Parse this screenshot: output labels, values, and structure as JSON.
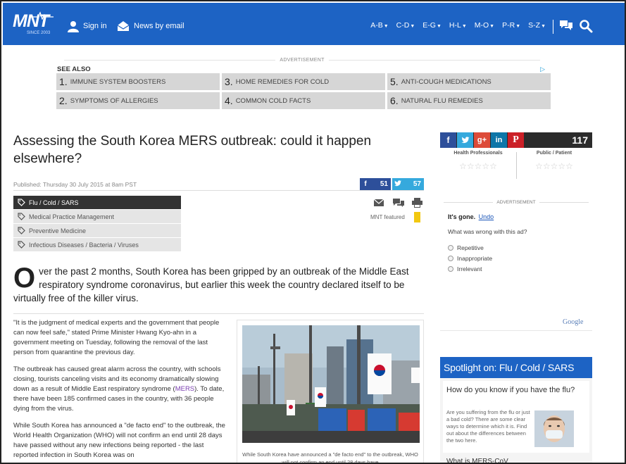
{
  "header": {
    "logo_text": "MNT",
    "logo_since": "SINCE 2003",
    "sign_in": "Sign in",
    "news_by_email": "News by email",
    "az_menu": [
      "A-B",
      "C-D",
      "E-G",
      "H-L",
      "M-O",
      "P-R",
      "S-Z"
    ]
  },
  "ad": {
    "label": "ADVERTISEMENT",
    "see_also": "SEE ALSO",
    "items": [
      {
        "num": "1.",
        "text": "IMMUNE SYSTEM BOOSTERS"
      },
      {
        "num": "3.",
        "text": "HOME REMEDIES FOR COLD"
      },
      {
        "num": "5.",
        "text": "ANTI-COUGH MEDICATIONS"
      },
      {
        "num": "2.",
        "text": "SYMPTOMS OF ALLERGIES"
      },
      {
        "num": "4.",
        "text": "COMMON COLD FACTS"
      },
      {
        "num": "6.",
        "text": "NATURAL FLU REMEDIES"
      }
    ]
  },
  "article": {
    "title": "Assessing the South Korea MERS outbreak: could it happen elsewhere?",
    "published": "Published: Thursday 30 July 2015 at 8am PST",
    "facebook_count": "51",
    "twitter_count": "57",
    "tags": [
      "Flu / Cold / SARS",
      "Medical Practice Management",
      "Preventive Medicine",
      "Infectious Diseases / Bacteria / Viruses"
    ],
    "mnt_featured": "MNT featured",
    "dropcap": "O",
    "lead": "ver the past 2 months, South Korea has been gripped by an outbreak of the Middle East respiratory syndrome coronavirus, but earlier this week the country declared itself to be virtually free of the killer virus.",
    "p1": "\"It is the judgment of medical experts and the government that people can now feel safe,\" stated Prime Minister Hwang Kyo-ahn in a government meeting on Tuesday, following the removal of the last person from quarantine the previous day.",
    "p2_a": "The outbreak has caused great alarm across the country, with schools closing, tourists canceling visits and its economy dramatically slowing down as a result of Middle East respiratory syndrome (",
    "p2_link": "MERS",
    "p2_b": "). To date, there have been 185 confirmed cases in the country, with 36 people dying from the virus.",
    "p3": "While South Korea has announced a \"de facto end\" to the outbreak, the World Health Organization (WHO) will not confirm an end until 28 days have passed without any new infections being reported - the last reported infection in South Korea was on",
    "caption": "While South Korea have announced a \"de facto end\" to the outbreak, WHO will not confirm an end until 28 days have"
  },
  "sidebar": {
    "share_total": "117",
    "rating_health_professionals": "Health Professionals",
    "rating_public_patient": "Public / Patient",
    "ad_label": "ADVERTISEMENT",
    "its_gone": "It's gone.",
    "undo": "Undo",
    "what_wrong": "What was wrong with this ad?",
    "options": [
      "Repetitive",
      "Inappropriate",
      "Irrelevant"
    ],
    "google": "Google",
    "spotlight_title": "Spotlight on: Flu / Cold / SARS",
    "spotlight_question": "How do you know if you have the flu?",
    "spotlight_desc": "Are you suffering from the flu or just a bad cold? There are some clear ways to determine which it is. Find out about the differences between the two here.",
    "spotlight_next": "What is MERS-CoV"
  },
  "colors": {
    "brand_blue": "#1d63c4",
    "facebook": "#2d4f9a",
    "twitter": "#35a9dd",
    "google_plus": "#dd4b39",
    "linkedin": "#0e76a8",
    "pinterest": "#cb2027",
    "bookmark": "#f2c811"
  },
  "icons": [
    "user-icon",
    "envelope-icon",
    "comments-icon",
    "search-icon",
    "tag-icon",
    "email-icon",
    "comment-icon",
    "print-icon",
    "bookmark-icon"
  ]
}
